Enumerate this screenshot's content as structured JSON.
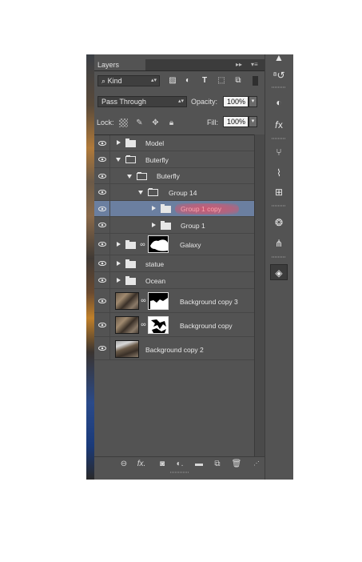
{
  "panel": {
    "tab_label": "Layers",
    "filter": {
      "kind_label": "Kind",
      "kind_icon": "search-icon"
    },
    "blend_mode": "Pass Through",
    "opacity_label": "Opacity:",
    "opacity_value": "100%",
    "lock_label": "Lock:",
    "fill_label": "Fill:",
    "fill_value": "100%"
  },
  "layers": [
    {
      "name": "Model",
      "type": "group",
      "expanded": false,
      "visible": true
    },
    {
      "name": "Buterfly",
      "type": "group",
      "expanded": true,
      "visible": true
    },
    {
      "name": "Buterfly",
      "type": "group",
      "expanded": true,
      "visible": true
    },
    {
      "name": "Group 14",
      "type": "group",
      "expanded": true,
      "visible": true
    },
    {
      "name": "Group 1 copy",
      "type": "group",
      "expanded": false,
      "visible": true,
      "selected": true,
      "highlight_color": "#e0526a"
    },
    {
      "name": "Group 1",
      "type": "group",
      "expanded": false,
      "visible": true
    },
    {
      "name": "Galaxy",
      "type": "group-with-mask",
      "expanded": false,
      "visible": true
    },
    {
      "name": "statue",
      "type": "group",
      "expanded": false,
      "visible": true
    },
    {
      "name": "Ocean",
      "type": "group",
      "expanded": false,
      "visible": true
    },
    {
      "name": "Background copy 3",
      "type": "layer-with-mask",
      "visible": true
    },
    {
      "name": "Background copy",
      "type": "layer-with-mask",
      "visible": true
    },
    {
      "name": "Background copy 2",
      "type": "layer",
      "visible": true
    }
  ],
  "footer_icons": [
    "link-icon",
    "fx-icon",
    "mask-icon",
    "adjustment-icon",
    "folder-icon",
    "new-layer-icon",
    "trash-icon"
  ],
  "right_toolbar_icons": [
    "history-icon",
    "color-icon",
    "styles-icon",
    "brush-icon",
    "brush-presets-icon",
    "clone-source-icon",
    "channels-icon",
    "paths-icon",
    "layers-icon"
  ],
  "colors": {
    "panel_bg": "#535353",
    "selected_row": "#6b7fa0"
  }
}
